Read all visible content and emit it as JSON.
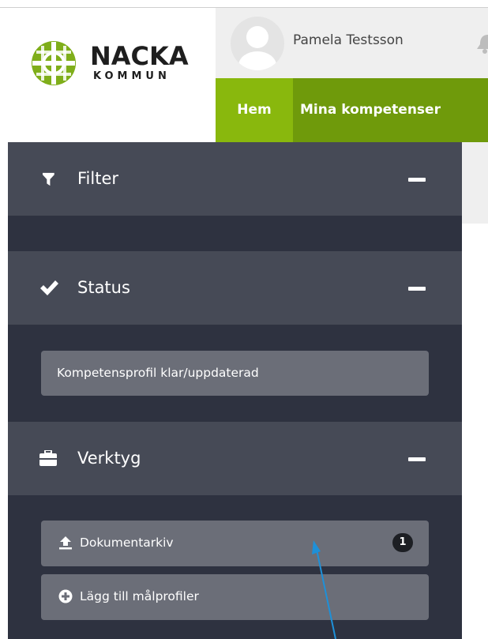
{
  "header": {
    "logo": {
      "line1": "NACKA",
      "line2": "KOMMUN"
    },
    "user": {
      "name": "Pamela Testsson"
    },
    "nav": {
      "home": "Hem",
      "mina": "Mina kompetenser"
    }
  },
  "sidebar": {
    "filter": {
      "title": "Filter",
      "icon": "filter-icon"
    },
    "status": {
      "title": "Status",
      "icon": "check-icon",
      "item": "Kompetensprofil klar/uppdaterad"
    },
    "verktyg": {
      "title": "Verktyg",
      "icon": "briefcase-icon",
      "items": [
        {
          "label": "Dokumentarkiv",
          "icon": "upload-icon",
          "badge": "1"
        },
        {
          "label": "Lägg till målprofiler",
          "icon": "plus-circle-icon"
        }
      ]
    }
  },
  "colors": {
    "sidebar_bg": "#2e3240",
    "section_header": "#464a56",
    "button": "#6b6e78",
    "nav_green": "#6f9a0b",
    "nav_active": "#89b80d",
    "logo_green": "#7fae1a",
    "annotation_arrow": "#1e90d8"
  }
}
